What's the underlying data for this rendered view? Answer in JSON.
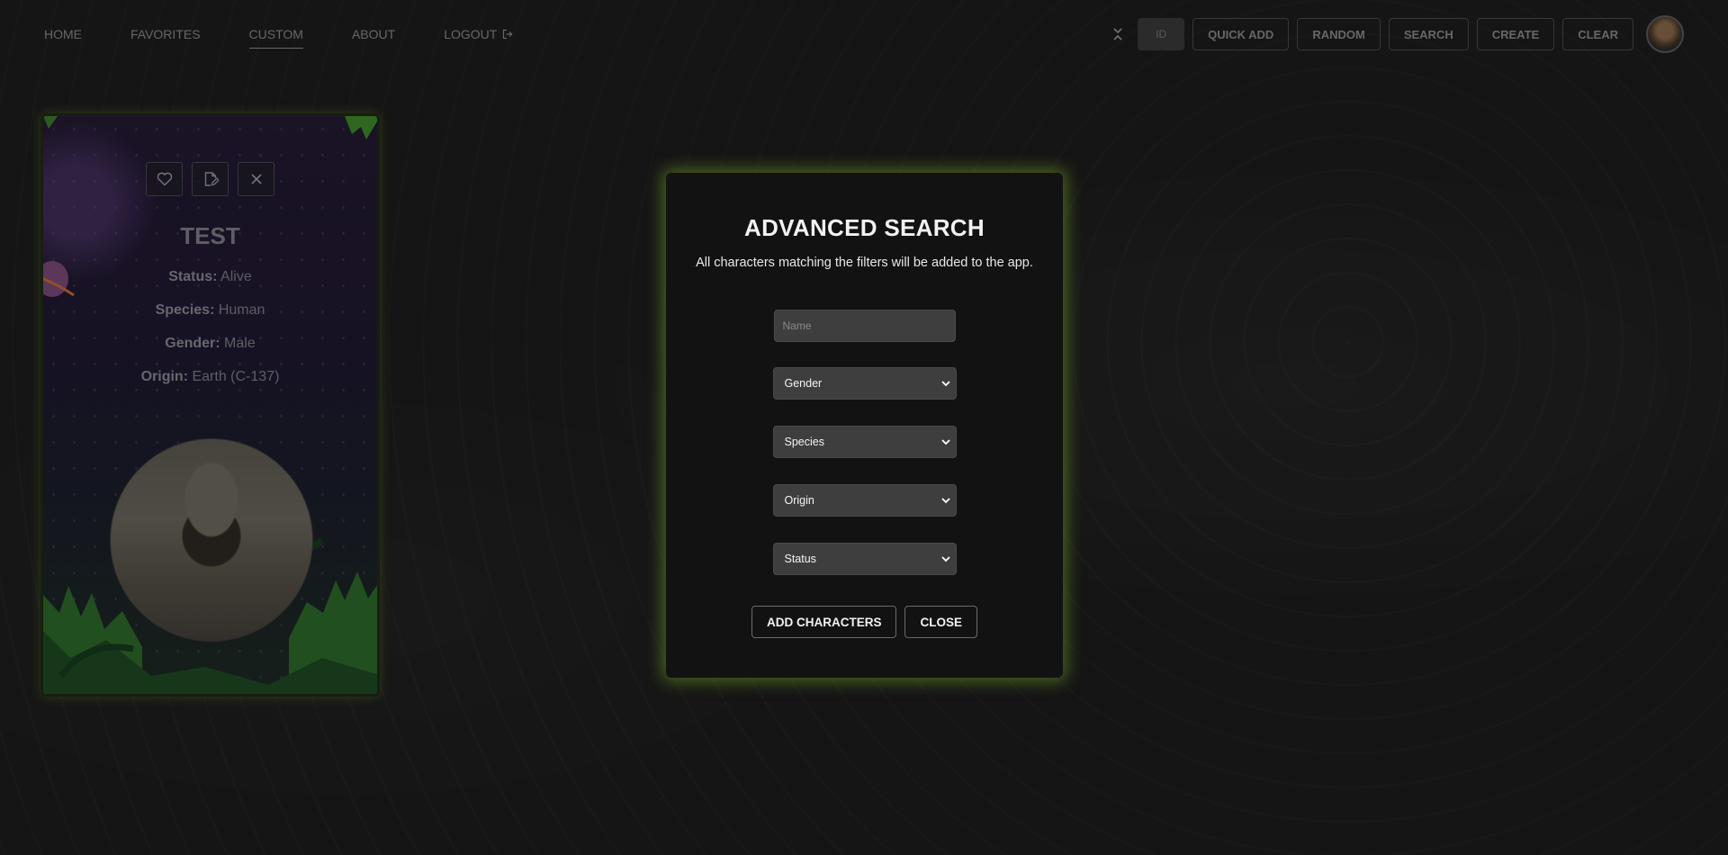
{
  "nav": {
    "links": [
      {
        "label": "HOME"
      },
      {
        "label": "FAVORITES"
      },
      {
        "label": "CUSTOM"
      },
      {
        "label": "ABOUT"
      },
      {
        "label": "LOGOUT"
      }
    ],
    "active_index": 2,
    "id_placeholder": "ID",
    "tools": {
      "quick_add": "QUICK ADD",
      "random": "RANDOM",
      "search": "SEARCH",
      "create": "CREATE",
      "clear": "CLEAR"
    }
  },
  "card": {
    "name": "TEST",
    "fields": [
      {
        "key": "Status:",
        "value": "Alive"
      },
      {
        "key": "Species:",
        "value": "Human"
      },
      {
        "key": "Gender:",
        "value": "Male"
      },
      {
        "key": "Origin:",
        "value": "Earth (C-137)"
      }
    ],
    "actions": [
      "heart-icon",
      "edit-icon",
      "close-icon"
    ]
  },
  "modal": {
    "title": "ADVANCED SEARCH",
    "subtitle": "All characters matching the filters will be added to the app.",
    "name_placeholder": "Name",
    "selects": {
      "gender": "Gender",
      "species": "Species",
      "origin": "Origin",
      "status": "Status"
    },
    "add_label": "ADD CHARACTERS",
    "close_label": "CLOSE"
  },
  "colors": {
    "glow": "#78aa28",
    "modal_bg": "#121212",
    "page_bg": "#1f1f1f"
  }
}
